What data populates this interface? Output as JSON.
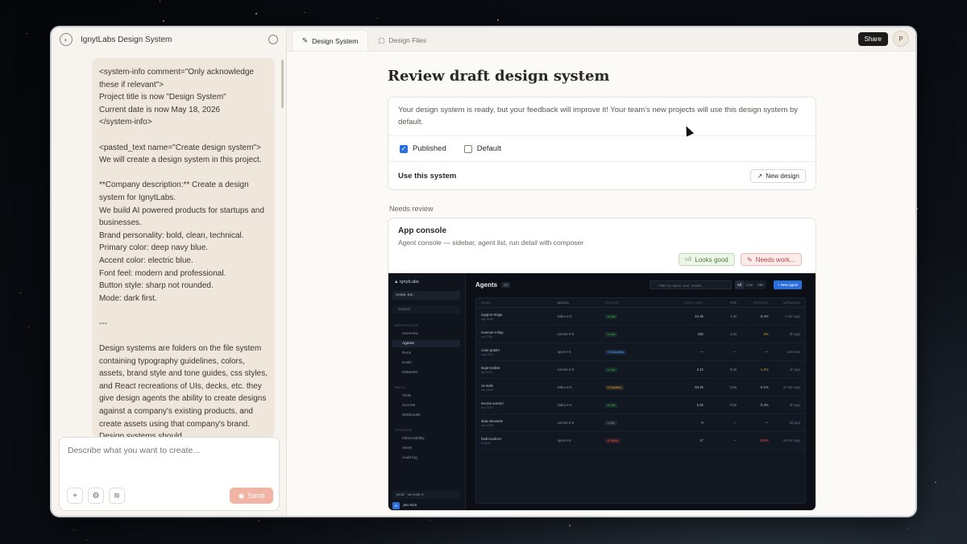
{
  "app": {
    "project_title": "IgnytLabs Design System",
    "tabs": [
      {
        "label": "Design System",
        "active": true
      },
      {
        "label": "Design Files",
        "active": false
      }
    ],
    "share_label": "Share",
    "avatar_initial": "P"
  },
  "chat": {
    "message": "<system-info comment=\"Only acknowledge these if relevant\">\nProject title is now \"Design System\"\nCurrent date is now May 18, 2026\n</system-info>\n\n<pasted_text name=\"Create design system\">\nWe will create a design system in this project.\n\n**Company description:** Create a design system for IgnytLabs.\nWe build AI powered products for startups and businesses.\nBrand personality: bold, clean, technical.\nPrimary color: deep navy blue.\nAccent color: electric blue.\nFont feel: modern and professional.\nButton style: sharp not rounded.\nMode: dark first.\n\n---\n\nDesign systems are folders on the file system containing typography guidelines, colors, assets, brand style and tone guides, css styles, and React recreations of UIs, decks, etc. they give design agents the ability to create designs against a company's existing products, and create assets using that company's brand. Design systems should",
    "composer_placeholder": "Describe what you want to create...",
    "send_label": "Send"
  },
  "review": {
    "page_title": "Review draft design system",
    "description": "Your design system is ready, but your feedback will improve it! Your team's new projects will use this design system by default.",
    "published_label": "Published",
    "published_checked": true,
    "default_label": "Default",
    "default_checked": false,
    "use_label": "Use this system",
    "new_design_label": "New design",
    "section_label": "Needs review",
    "item_title": "App console",
    "item_subtitle": "Agent console — sidebar, agent list, run detail with composer",
    "looks_good_label": "Looks good",
    "needs_work_label": "Needs work..."
  },
  "preview": {
    "brand": "IgnytLabs",
    "workspace": "Acme, Inc.",
    "search": "Search",
    "groups": [
      {
        "label": "WORKSPACE",
        "items": [
          "Overview",
          "Agents",
          "Runs",
          "Evals",
          "Datasets"
        ]
      },
      {
        "label": "BUILD",
        "items": [
          "Tools",
          "Secrets",
          "Webhooks"
        ]
      },
      {
        "label": "OPERATE",
        "items": [
          "Observability",
          "Alerts",
          "Audit log"
        ]
      }
    ],
    "active_item": "Agents",
    "footer_env": "prod · us-east-1",
    "user_initials": "JK",
    "user_name": "Jen Kim",
    "title": "Agents",
    "count": "12",
    "filter_placeholder": "Filter by name, tool, model...",
    "segments": [
      "All",
      "Live",
      "Idle"
    ],
    "new_agent_label": "+ New agent",
    "columns": [
      "NAME",
      "MODEL",
      "STATUS",
      "COST (24H)",
      "P95",
      "ERRORS",
      "UPDATED"
    ],
    "rows": [
      {
        "name": "support-triage",
        "id": "agt-39qb",
        "model": "haiku-4-5",
        "status": "Live",
        "cost": "12.4k",
        "p95": "1.2s",
        "err": "0.4%",
        "upd": "2 min ago"
      },
      {
        "name": "revenue-rollup",
        "id": "rev-71fa",
        "model": "sonnet-4-5",
        "status": "Live",
        "cost": "428",
        "p95": "4.1s",
        "err": "3%",
        "upd": "8h ago"
      },
      {
        "name": "code-grader",
        "id": "cog-34c2",
        "model": "opus-4-5",
        "status": "Evaluating",
        "cost": "—",
        "p95": "—",
        "err": "—",
        "upd": "just now"
      },
      {
        "name": "legal-redline",
        "id": "lgl-0h32",
        "model": "sonnet-4-5",
        "status": "Live",
        "cost": "2.1k",
        "p95": "8.4s",
        "err": "1.2%",
        "upd": "1h ago"
      },
      {
        "name": "ca-suite",
        "id": "act-19x5",
        "model": "haiku-4-5",
        "status": "Throttled",
        "cost": "94.2k",
        "p95": "0.6s",
        "err": "0.1%",
        "upd": "10 min ago"
      },
      {
        "name": "invoice-extract",
        "id": "inv-7732",
        "model": "haiku-4-5",
        "status": "Live",
        "cost": "5.2k",
        "p95": "0.9s",
        "err": "0.3%",
        "upd": "3h ago"
      },
      {
        "name": "data-stewards",
        "id": "dst-2298",
        "model": "sonnet-4-5",
        "status": "Idle",
        "cost": "0",
        "p95": "—",
        "err": "—",
        "upd": "5d ago"
      },
      {
        "name": "fault-localizer",
        "id": "flt-8k41",
        "model": "opus-4-5",
        "status": "Failed",
        "cost": "17",
        "p95": "—",
        "err": "100%",
        "upd": "18 min ago"
      }
    ],
    "status_colors": {
      "Live": "#3fb950",
      "Evaluating": "#58a6ff",
      "Throttled": "#e3a33b",
      "Idle": "#8b949e",
      "Failed": "#f85149"
    }
  }
}
